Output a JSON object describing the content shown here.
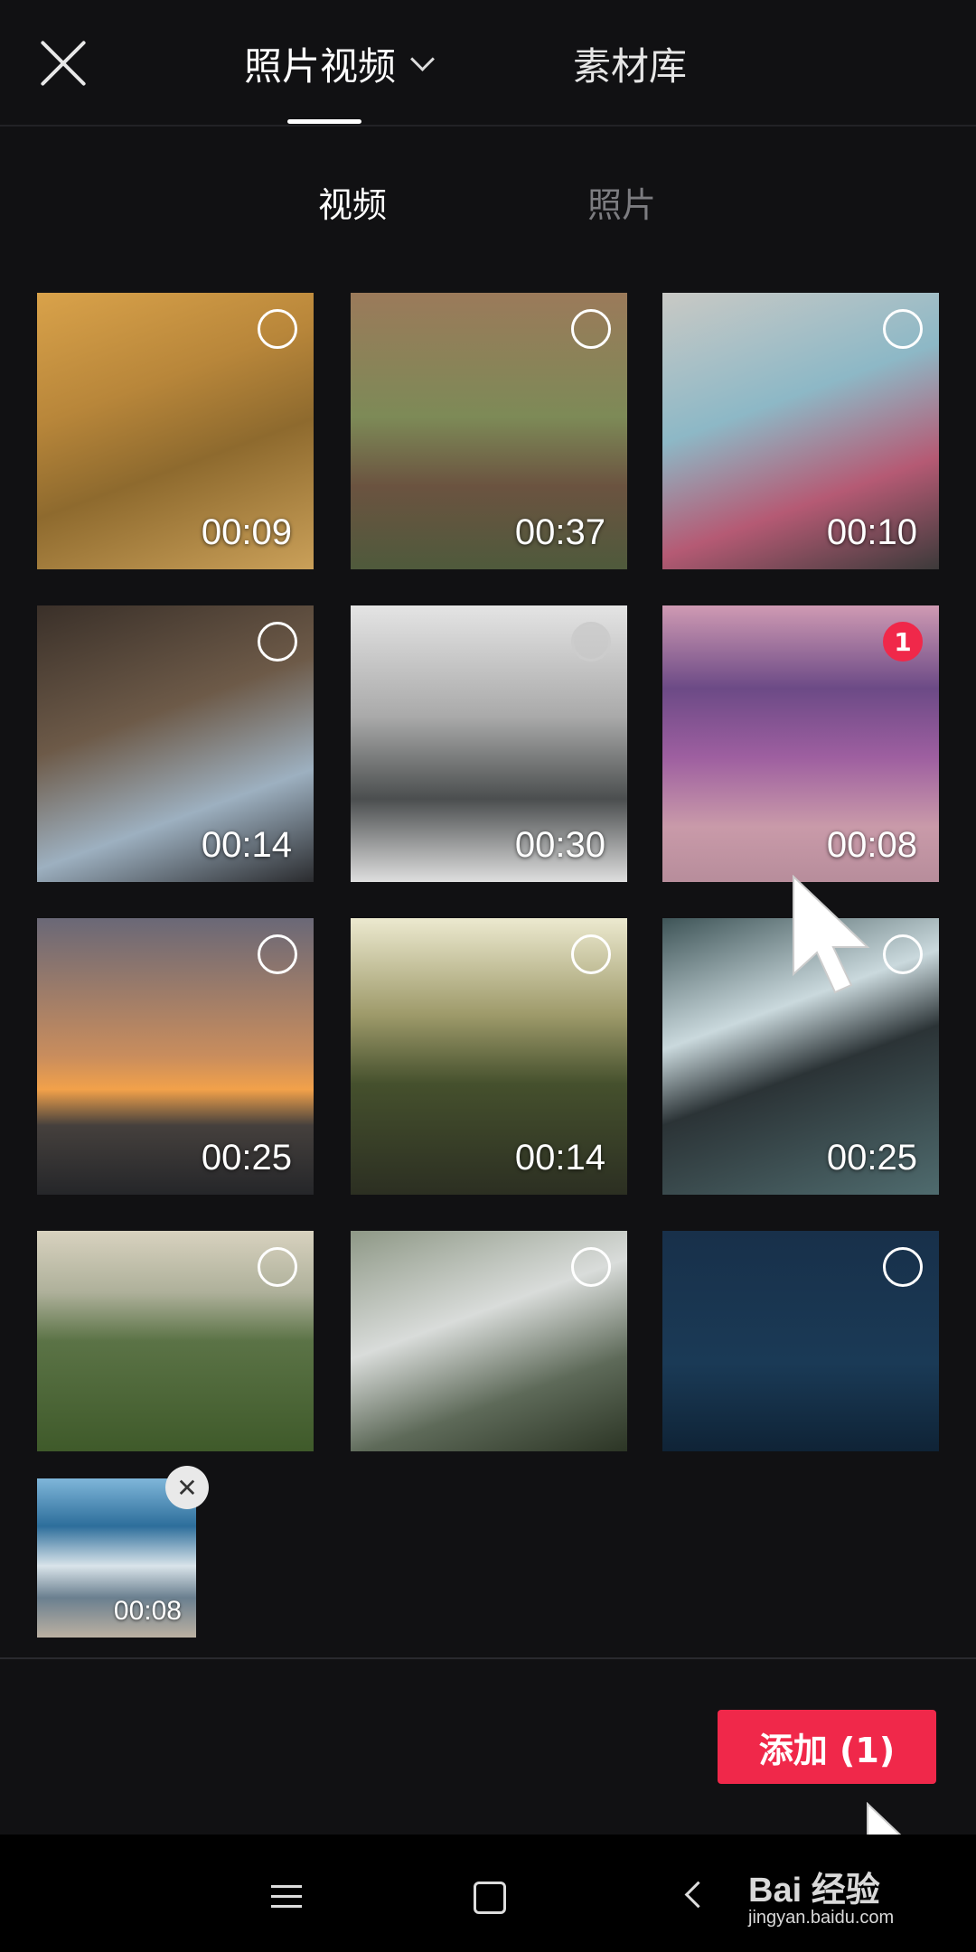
{
  "header": {
    "close_icon": "close-icon",
    "tab_main": "照片视频",
    "tab_main_icon": "chevron-down-icon",
    "tab_library": "素材库"
  },
  "subtabs": {
    "video": "视频",
    "photo": "照片"
  },
  "grid": [
    {
      "duration": "00:09",
      "selected": false
    },
    {
      "duration": "00:37",
      "selected": false
    },
    {
      "duration": "00:10",
      "selected": false
    },
    {
      "duration": "00:14",
      "selected": false
    },
    {
      "duration": "00:30",
      "selected": false
    },
    {
      "duration": "00:08",
      "selected": true,
      "index": "1"
    },
    {
      "duration": "00:25",
      "selected": false
    },
    {
      "duration": "00:14",
      "selected": false
    },
    {
      "duration": "00:25",
      "selected": false
    },
    {
      "duration": "",
      "selected": false
    },
    {
      "duration": "",
      "selected": false
    },
    {
      "duration": "",
      "selected": false
    }
  ],
  "selected_tray": {
    "duration": "00:08",
    "remove_icon": "✕"
  },
  "add_button": "添加 (1)",
  "watermark": {
    "line1": "Bai 经验",
    "line2": "jingyan.baidu.com"
  },
  "colors": {
    "accent": "#f0284a",
    "background": "#111113"
  }
}
